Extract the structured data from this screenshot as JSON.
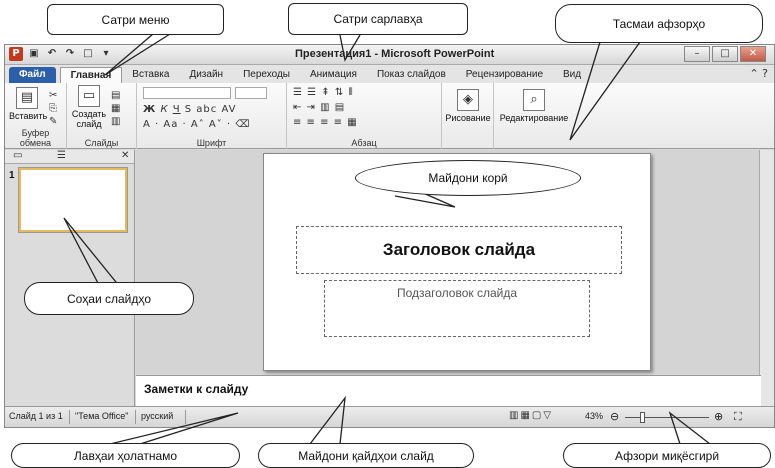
{
  "annotations": {
    "menu_bar": "Сатри меню",
    "title_bar": "Сатри сарлавҳа",
    "ribbon": "Тасмаи афзорҳо",
    "workspace": "Майдони корӣ",
    "slides_pane": "Соҳаи слайдҳо",
    "status_bar": "Лавҳаи ҳолатнамо",
    "notes_area": "Майдони қайдҳои слайд",
    "zoom_tool": "Афзори миқёсгирӣ"
  },
  "window": {
    "title": "Презентация1 - Microsoft PowerPoint"
  },
  "tabs": [
    "Файл",
    "Главная",
    "Вставка",
    "Дизайн",
    "Переходы",
    "Анимация",
    "Показ слайдов",
    "Рецензирование",
    "Вид"
  ],
  "ribbon": {
    "paste": "Вставить",
    "create_slide_1": "Создать",
    "create_slide_2": "слайд",
    "drawing": "Рисование",
    "editing": "Редактирование",
    "groups": {
      "clipboard": "Буфер обмена",
      "slides": "Слайды",
      "font": "Шрифт",
      "paragraph": "Абзац"
    }
  },
  "slides_panel": {
    "thumb_number": "1"
  },
  "slide": {
    "title_placeholder": "Заголовок слайда",
    "subtitle_placeholder": "Подзаголовок слайда"
  },
  "notes": {
    "placeholder": "Заметки к слайду"
  },
  "status": {
    "slide_info": "Слайд 1 из 1",
    "theme": "\"Тема Office\"",
    "language": "русский",
    "zoom": "43%",
    "zoom_level": 0.43
  }
}
